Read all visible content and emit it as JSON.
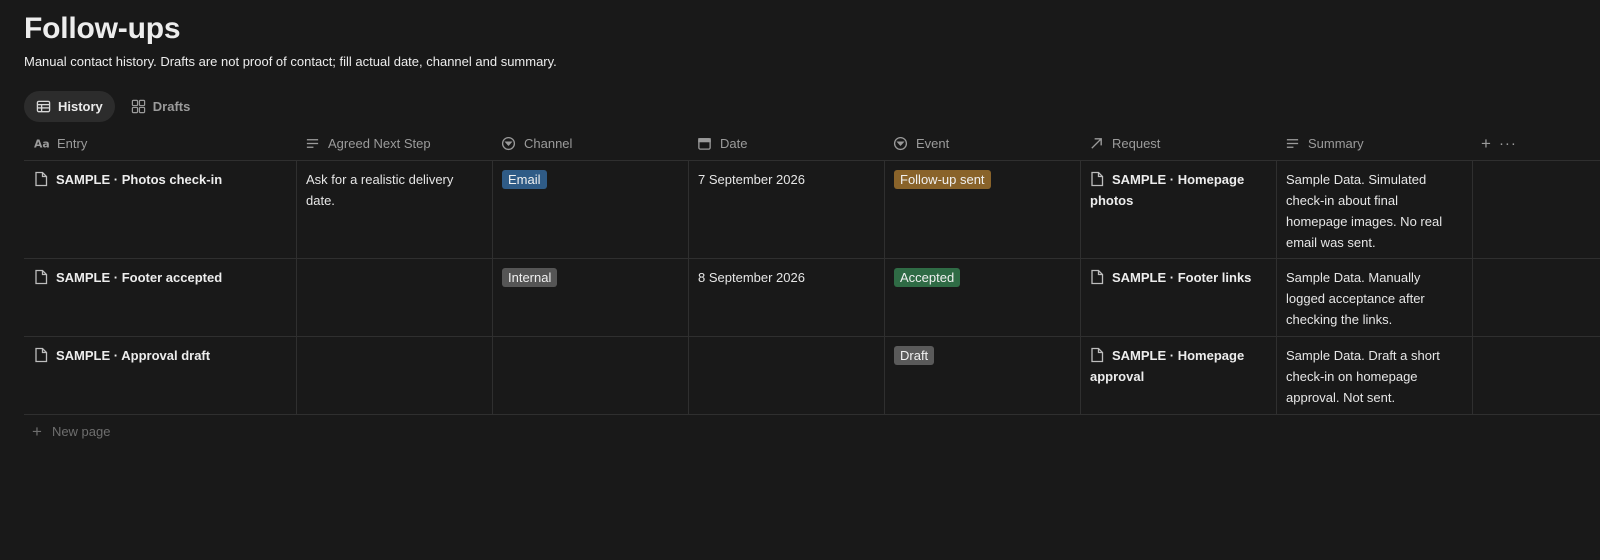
{
  "page": {
    "title": "Follow-ups",
    "description": "Manual contact history. Drafts are not proof of contact; fill actual date, channel and summary."
  },
  "tabs": [
    {
      "label": "History",
      "icon": "table-icon",
      "active": true
    },
    {
      "label": "Drafts",
      "icon": "grid-icon",
      "active": false
    }
  ],
  "columns": {
    "entry": "Entry",
    "next": "Agreed Next Step",
    "channel": "Channel",
    "date": "Date",
    "event": "Event",
    "request": "Request",
    "summary": "Summary",
    "add": "+",
    "more": "···"
  },
  "rows": [
    {
      "entry": "SAMPLE · Photos check-in",
      "next": "Ask for a realistic delivery date.",
      "channel": "Email",
      "date": "7 September 2026",
      "event": "Follow-up sent",
      "request": "SAMPLE · Homepage photos",
      "summary": "Sample Data. Simulated check-in about final homepage images. No real email was sent."
    },
    {
      "entry": "SAMPLE · Footer accepted",
      "next": "",
      "channel": "Internal",
      "date": "8 September 2026",
      "event": "Accepted",
      "request": "SAMPLE · Footer links",
      "summary": "Sample Data. Manually logged acceptance after checking the links."
    },
    {
      "entry": "SAMPLE · Approval draft",
      "next": "",
      "channel": "",
      "date": "",
      "event": "Draft",
      "request": "SAMPLE · Homepage approval",
      "summary": "Sample Data. Draft a short check-in on homepage approval. Not sent."
    }
  ],
  "footer": {
    "new_page": "New page"
  },
  "colors": {
    "background": "#191919",
    "email_tag": "#2f5b86",
    "internal_tag": "#555555",
    "followup_tag": "#89632a",
    "accepted_tag": "#2f6b45",
    "draft_tag": "#5a5a5a"
  }
}
